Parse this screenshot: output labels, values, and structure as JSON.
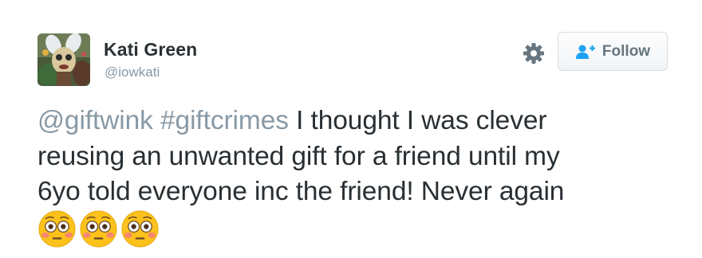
{
  "user": {
    "display_name": "Kati Green",
    "handle": "@iowkati"
  },
  "actions": {
    "settings_icon": "gear-icon",
    "follow_icon": "add-user-icon",
    "follow_label": "Follow"
  },
  "tweet": {
    "mention": "@giftwink",
    "hashtag": "#giftcrimes",
    "line1_text": " I thought I was clever",
    "line2": "reusing an unwanted gift for a friend until my",
    "line3": "6yo told everyone inc the friend! Never again",
    "emojis": [
      "flushed-face-emoji",
      "flushed-face-emoji",
      "flushed-face-emoji"
    ]
  },
  "colors": {
    "text": "#292f33",
    "muted": "#8899a6",
    "follow_blue": "#1da1f2",
    "emoji_yellow": "#fcc21b"
  }
}
